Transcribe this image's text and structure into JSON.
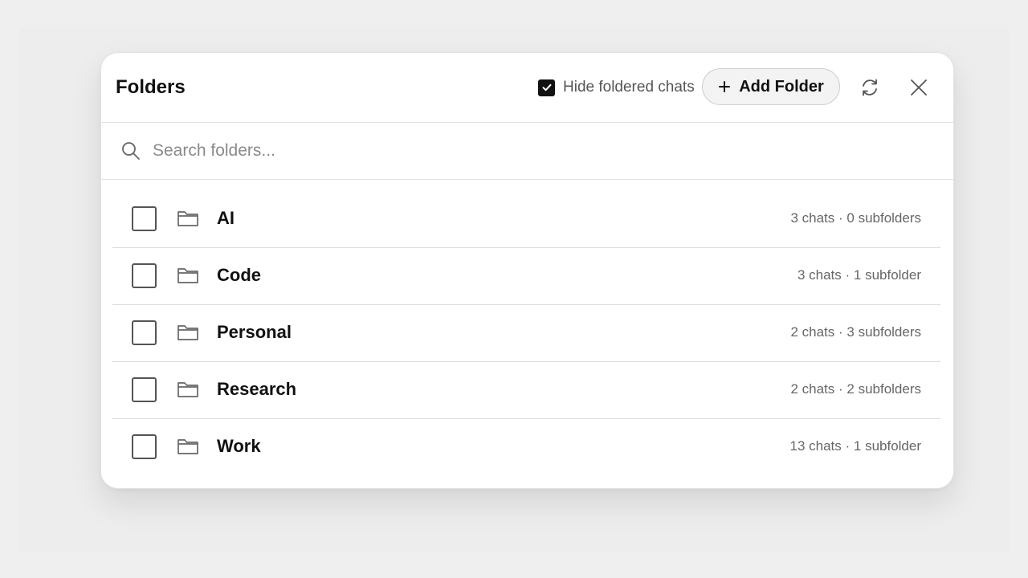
{
  "dialog": {
    "title": "Folders",
    "hide_foldered_label": "Hide foldered chats",
    "hide_foldered_checked": true,
    "add_folder_label": "Add Folder"
  },
  "search": {
    "placeholder": "Search folders..."
  },
  "folders": [
    {
      "name": "AI",
      "meta": "3 chats · 0 subfolders",
      "selected": false
    },
    {
      "name": "Code",
      "meta": "3 chats · 1 subfolder",
      "selected": false
    },
    {
      "name": "Personal",
      "meta": "2 chats · 3 subfolders",
      "selected": false
    },
    {
      "name": "Research",
      "meta": "2 chats · 2 subfolders",
      "selected": false
    },
    {
      "name": "Work",
      "meta": "13 chats · 1 subfolder",
      "selected": false
    }
  ],
  "icons": {
    "search": "search-icon",
    "folder": "folder-icon",
    "refresh": "refresh-icon",
    "close": "close-icon",
    "plus": "plus-icon",
    "check": "checkmark-icon"
  },
  "colors": {
    "accent": "#111111",
    "muted_text": "#666666",
    "background": "#efefef"
  }
}
